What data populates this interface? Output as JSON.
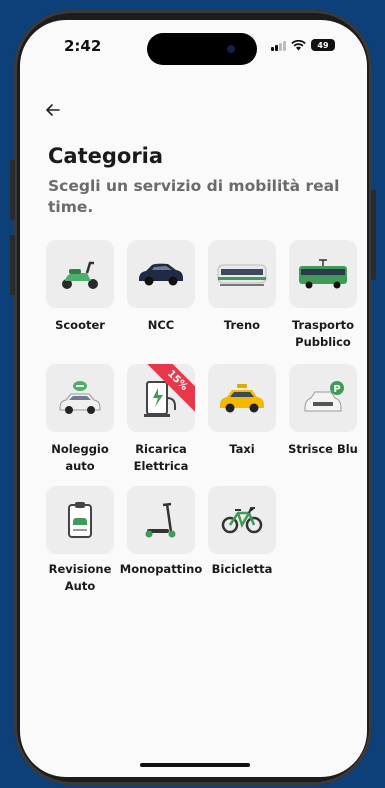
{
  "status_bar": {
    "time": "2:42",
    "battery": "49"
  },
  "header": {
    "back_icon": "arrow-left-icon",
    "title": "Categoria",
    "subtitle": "Scegli un servizio di mobilità real time."
  },
  "categories": [
    {
      "label": "Scooter",
      "icon": "scooter-icon"
    },
    {
      "label": "NCC",
      "icon": "car-icon"
    },
    {
      "label": "Treno",
      "icon": "train-icon"
    },
    {
      "label": "Trasporto Pubblico",
      "icon": "bus-icon"
    },
    {
      "label": "Noleggio auto",
      "icon": "rental-car-icon"
    },
    {
      "label": "Ricarica Elettrica",
      "icon": "charging-station-icon",
      "badge": "15%"
    },
    {
      "label": "Taxi",
      "icon": "taxi-icon"
    },
    {
      "label": "Strisce Blu",
      "icon": "parking-car-icon"
    },
    {
      "label": "Revisione Auto",
      "icon": "inspection-clipboard-icon"
    },
    {
      "label": "Monopattino",
      "icon": "kick-scooter-icon"
    },
    {
      "label": "Bicicletta",
      "icon": "bicycle-icon"
    }
  ],
  "colors": {
    "background": "#0d3f78",
    "badge": "#e8374a",
    "tile": "#ededed"
  }
}
